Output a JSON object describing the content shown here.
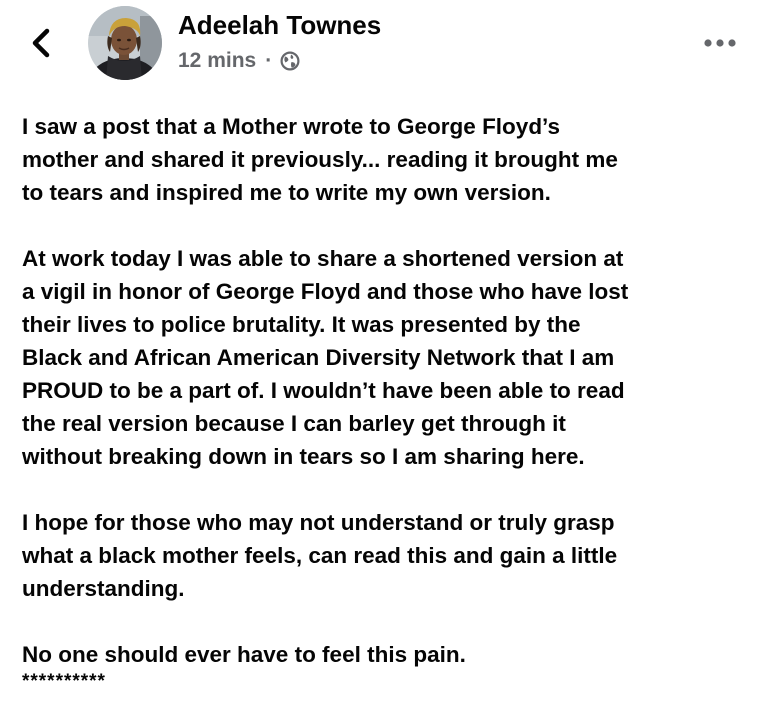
{
  "header": {
    "back_icon": "chevron-left-icon",
    "author_name": "Adeelah Townes",
    "timestamp": "12 mins",
    "separator": "·",
    "privacy_icon": "globe-icon",
    "more_icon": "more-horizontal-icon"
  },
  "post": {
    "paragraphs": [
      "I saw a post that a Mother wrote to George Floyd’s\nmother and shared it previously... reading it brought me\nto tears and inspired me to write my own version.",
      "At work today I was able to share a shortened version at\na vigil in honor of George Floyd and those who have lost\ntheir lives to police brutality. It was presented by the\nBlack and African American Diversity Network that I am\nPROUD to be a part of.  I wouldn’t have been able to read\nthe real version because I can barley get through it\nwithout breaking down in tears so I am sharing here.",
      "I hope for those who may not understand or truly grasp\nwhat a black mother feels, can read this and gain a little\nunderstanding.",
      "No one should ever have to feel this pain."
    ],
    "stars": "**********"
  },
  "colors": {
    "text_primary": "#050505",
    "text_secondary": "#65676b",
    "background": "#ffffff"
  }
}
